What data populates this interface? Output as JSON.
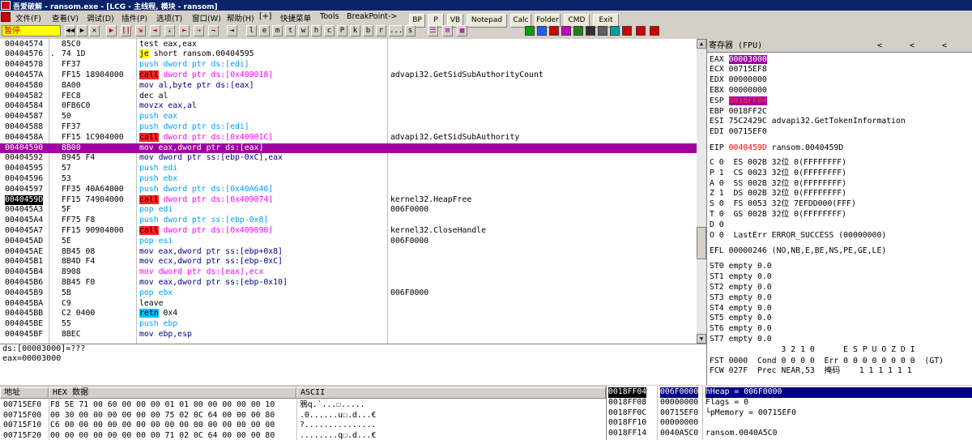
{
  "titlebar": {
    "title": "吾爱破解 - ransom.exe - [LCG - 主线程, 模块 - ransom]"
  },
  "menu": [
    "文件(F)",
    "查看(V)",
    "调试(D)",
    "插件(P)",
    "选项(T)",
    "窗口(W)",
    "帮助(H)",
    "[+]",
    "快捷菜单",
    "Tools",
    "BreakPoint->"
  ],
  "quick_buttons": [
    "BP",
    "P",
    "VB",
    "Notepad",
    "Calc",
    "Folder",
    "CMD",
    "Exit"
  ],
  "toolbar": {
    "status": "暂停",
    "letters": [
      "l",
      "e",
      "m",
      "t",
      "w",
      "h",
      "c",
      "P",
      "k",
      "b",
      "r",
      "...",
      "s"
    ]
  },
  "cpu_rows": [
    {
      "addr": "00404574",
      "arrow": "",
      "hex": "85C0",
      "asm": [
        [
          "test eax,eax",
          ""
        ]
      ],
      "cmt": ""
    },
    {
      "addr": "00404576",
      "arrow": ".",
      "hex": "74 1D",
      "asm": [
        [
          "je",
          "jmp"
        ],
        [
          " short ransom.00404595",
          ""
        ]
      ],
      "cmt": ""
    },
    {
      "addr": "00404578",
      "arrow": "",
      "hex": "FF37",
      "asm": [
        [
          "push dword ptr ds:[edi]",
          "push"
        ]
      ],
      "cmt": ""
    },
    {
      "addr": "0040457A",
      "arrow": "",
      "hex": "FF15 18904000",
      "asm": [
        [
          "call",
          "call"
        ],
        [
          " dword ptr ds:[0x409018]",
          "callarg"
        ]
      ],
      "cmt": "advapi32.GetSidSubAuthorityCount"
    },
    {
      "addr": "00404580",
      "arrow": "",
      "hex": "8A00",
      "asm": [
        [
          "mov al,byte ptr ds:[eax]",
          "mov"
        ]
      ],
      "cmt": ""
    },
    {
      "addr": "00404582",
      "arrow": "",
      "hex": "FEC8",
      "asm": [
        [
          "dec al",
          ""
        ]
      ],
      "cmt": ""
    },
    {
      "addr": "00404584",
      "arrow": "",
      "hex": "0FB6C0",
      "asm": [
        [
          "movzx eax,al",
          "mov"
        ]
      ],
      "cmt": ""
    },
    {
      "addr": "00404587",
      "arrow": "",
      "hex": "50",
      "asm": [
        [
          "push eax",
          "push"
        ]
      ],
      "cmt": ""
    },
    {
      "addr": "00404588",
      "arrow": "",
      "hex": "FF37",
      "asm": [
        [
          "push dword ptr ds:[edi]",
          "push"
        ]
      ],
      "cmt": ""
    },
    {
      "addr": "0040458A",
      "arrow": "",
      "hex": "FF15 1C904000",
      "asm": [
        [
          "call",
          "call"
        ],
        [
          " dword ptr ds:[0x40901C]",
          "callarg"
        ]
      ],
      "cmt": "advapi32.GetSidSubAuthority"
    },
    {
      "addr": "00404590",
      "arrow": "",
      "hex": "8B00",
      "asm": [
        [
          "mov eax,dword ptr ds:[eax]",
          ""
        ]
      ],
      "cmt": "",
      "sel": true
    },
    {
      "addr": "00404592",
      "arrow": "",
      "hex": "8945 F4",
      "asm": [
        [
          "mov dword ptr ss:[ebp-0xC],eax",
          "mov"
        ]
      ],
      "cmt": ""
    },
    {
      "addr": "00404595",
      "arrow": "",
      "hex": "57",
      "asm": [
        [
          "push edi",
          "push"
        ]
      ],
      "cmt": ""
    },
    {
      "addr": "00404596",
      "arrow": "",
      "hex": "53",
      "asm": [
        [
          "push ebx",
          "push"
        ]
      ],
      "cmt": ""
    },
    {
      "addr": "00404597",
      "arrow": "",
      "hex": "FF35 40A64000",
      "asm": [
        [
          "push dword ptr ds:[0x40A640]",
          "push"
        ]
      ],
      "cmt": ""
    },
    {
      "addr": "0040459D",
      "arrow": "",
      "hex": "FF15 74904000",
      "asm": [
        [
          "call",
          "call"
        ],
        [
          " dword ptr ds:[0x409074]",
          "callarg"
        ]
      ],
      "cmt": "kernel32.HeapFree",
      "cur": true
    },
    {
      "addr": "004045A3",
      "arrow": "",
      "hex": "5F",
      "asm": [
        [
          "pop edi",
          "pop"
        ]
      ],
      "cmt": "006F0000"
    },
    {
      "addr": "004045A4",
      "arrow": "",
      "hex": "FF75 F8",
      "asm": [
        [
          "push dword ptr ss:[ebp-0x8]",
          "push"
        ]
      ],
      "cmt": ""
    },
    {
      "addr": "004045A7",
      "arrow": "",
      "hex": "FF15 90904000",
      "asm": [
        [
          "call",
          "call"
        ],
        [
          " dword ptr ds:[0x409090]",
          "callarg"
        ]
      ],
      "cmt": "kernel32.CloseHandle"
    },
    {
      "addr": "004045AD",
      "arrow": "",
      "hex": "5E",
      "asm": [
        [
          "pop esi",
          "pop"
        ]
      ],
      "cmt": "006F0000"
    },
    {
      "addr": "004045AE",
      "arrow": "",
      "hex": "8B45 08",
      "asm": [
        [
          "mov eax,dword ptr ss:[ebp+0x8]",
          "mov"
        ]
      ],
      "cmt": ""
    },
    {
      "addr": "004045B1",
      "arrow": "",
      "hex": "8B4D F4",
      "asm": [
        [
          "mov ecx,dword ptr ss:[ebp-0xC]",
          "mov"
        ]
      ],
      "cmt": ""
    },
    {
      "addr": "004045B4",
      "arrow": "",
      "hex": "8908",
      "asm": [
        [
          "mov dword ptr ds:[eax],ecx",
          "callarg"
        ]
      ],
      "cmt": ""
    },
    {
      "addr": "004045B6",
      "arrow": "",
      "hex": "8B45 F0",
      "asm": [
        [
          "mov eax,dword ptr ss:[ebp-0x10]",
          "mov"
        ]
      ],
      "cmt": ""
    },
    {
      "addr": "004045B9",
      "arrow": "",
      "hex": "5B",
      "asm": [
        [
          "pop ebx",
          "pop"
        ]
      ],
      "cmt": "006F0000"
    },
    {
      "addr": "004045BA",
      "arrow": "",
      "hex": "C9",
      "asm": [
        [
          "leave",
          ""
        ]
      ],
      "cmt": ""
    },
    {
      "addr": "004045BB",
      "arrow": "",
      "hex": "C2 0400",
      "asm": [
        [
          "retn",
          "ret"
        ],
        [
          " 0x4",
          ""
        ]
      ],
      "cmt": ""
    },
    {
      "addr": "004045BE",
      "arrow": "",
      "hex": "55",
      "asm": [
        [
          "push ebp",
          "push"
        ]
      ],
      "cmt": ""
    },
    {
      "addr": "004045BF",
      "arrow": "",
      "hex": "8BEC",
      "asm": [
        [
          "mov ebp,esp",
          "mov"
        ]
      ],
      "cmt": ""
    }
  ],
  "info": {
    "line1": "ds:[00003000]=???",
    "line2": "eax=00003000"
  },
  "registers": {
    "header": "寄存器 (FPU)",
    "lines": [
      {
        "t": "EAX ",
        "v": "00003000",
        "s": "",
        "style": "hl"
      },
      {
        "t": "ECX 00715EF8",
        "v": "",
        "s": "",
        "style": ""
      },
      {
        "t": "EDX 00000000",
        "v": "",
        "s": "",
        "style": ""
      },
      {
        "t": "EBX 00000000",
        "v": "",
        "s": "",
        "style": ""
      },
      {
        "t": "ESP ",
        "v": "0018FF04",
        "s": "",
        "style": "hlred"
      },
      {
        "t": "EBP 0018FF2C",
        "v": "",
        "s": "",
        "style": ""
      },
      {
        "t": "ESI 75C2429C advapi32.GetTokenInformation",
        "v": "",
        "s": "",
        "style": ""
      },
      {
        "t": "EDI 00715EF0",
        "v": "",
        "s": "",
        "style": ""
      },
      {
        "t": "EIP ",
        "v": "0040459D",
        "s": " ransom.0040459D",
        "style": "red"
      },
      {
        "t": "C 0  ES 002B 32位 0(FFFFFFFF)",
        "v": "",
        "s": "",
        "style": ""
      },
      {
        "t": "P 1  CS 0023 32位 0(FFFFFFFF)",
        "v": "",
        "s": "",
        "style": ""
      },
      {
        "t": "A 0  SS 002B 32位 0(FFFFFFFF)",
        "v": "",
        "s": "",
        "style": ""
      },
      {
        "t": "Z 1  DS 002B 32位 0(FFFFFFFF)",
        "v": "",
        "s": "",
        "style": ""
      },
      {
        "t": "S 0  FS 0053 32位 7EFDD000(FFF)",
        "v": "",
        "s": "",
        "style": ""
      },
      {
        "t": "T 0  GS 002B 32位 0(FFFFFFFF)",
        "v": "",
        "s": "",
        "style": ""
      },
      {
        "t": "D 0",
        "v": "",
        "s": "",
        "style": ""
      },
      {
        "t": "O 0  LastErr ERROR_SUCCESS (00000000)",
        "v": "",
        "s": "",
        "style": ""
      },
      {
        "t": "EFL 00000246 (NO,NB,E,BE,NS,PE,GE,LE)",
        "v": "",
        "s": "",
        "style": ""
      },
      {
        "t": "ST0 empty 0.0",
        "v": "",
        "s": "",
        "style": ""
      },
      {
        "t": "ST1 empty 0.0",
        "v": "",
        "s": "",
        "style": ""
      },
      {
        "t": "ST2 empty 0.0",
        "v": "",
        "s": "",
        "style": ""
      },
      {
        "t": "ST3 empty 0.0",
        "v": "",
        "s": "",
        "style": ""
      },
      {
        "t": "ST4 empty 0.0",
        "v": "",
        "s": "",
        "style": ""
      },
      {
        "t": "ST5 empty 0.0",
        "v": "",
        "s": "",
        "style": ""
      },
      {
        "t": "ST6 empty 0.0",
        "v": "",
        "s": "",
        "style": ""
      },
      {
        "t": "ST7 empty 0.0",
        "v": "",
        "s": "",
        "style": ""
      },
      {
        "t": "               3 2 1 0      E S P U O Z D I",
        "v": "",
        "s": "",
        "style": ""
      },
      {
        "t": "FST 0000  Cond 0 0 0 0  Err 0 0 0 0 0 0 0 0  (GT)",
        "v": "",
        "s": "",
        "style": ""
      },
      {
        "t": "FCW 027F  Prec NEAR,53  掩码    1 1 1 1 1 1",
        "v": "",
        "s": "",
        "style": ""
      }
    ]
  },
  "dump": {
    "headers": [
      "地址",
      "HEX 数据",
      "ASCII"
    ],
    "rows": [
      {
        "addr": "00715EF0",
        "hex": "F8 5E 71 00 60 00 00 00 01 01 00 00 00 00 00 10",
        "ascii": "鴉q.`...☐....."
      },
      {
        "addr": "00715F00",
        "hex": "00 30 00 00 00 00 00 00 75 02 0C 64 00 00 00 80",
        "ascii": ".0......u☐.d...€"
      },
      {
        "addr": "00715F10",
        "hex": "C6 00 00 00 00 00 00 00 00 00 00 00 00 00 00 00",
        "ascii": "?..............."
      },
      {
        "addr": "00715F20",
        "hex": "00 00 00 00 00 00 00 00 71 02 0C 64 00 00 00 80",
        "ascii": "........q☐.d...€"
      }
    ]
  },
  "stack": [
    {
      "addr": "0018FF04",
      "val": "006F0000",
      "cmt": "hHeap = 006F0000",
      "sel": true
    },
    {
      "addr": "0018FF08",
      "val": "00000000",
      "cmt": "Flags = 0"
    },
    {
      "addr": "0018FF0C",
      "val": "00715EF0",
      "cmt": "└pMemory = 00715EF0"
    },
    {
      "addr": "0018FF10",
      "val": "00000000",
      "cmt": ""
    },
    {
      "addr": "0018FF14",
      "val": "0040A5C0",
      "cmt": "ransom.0040A5C0"
    }
  ]
}
